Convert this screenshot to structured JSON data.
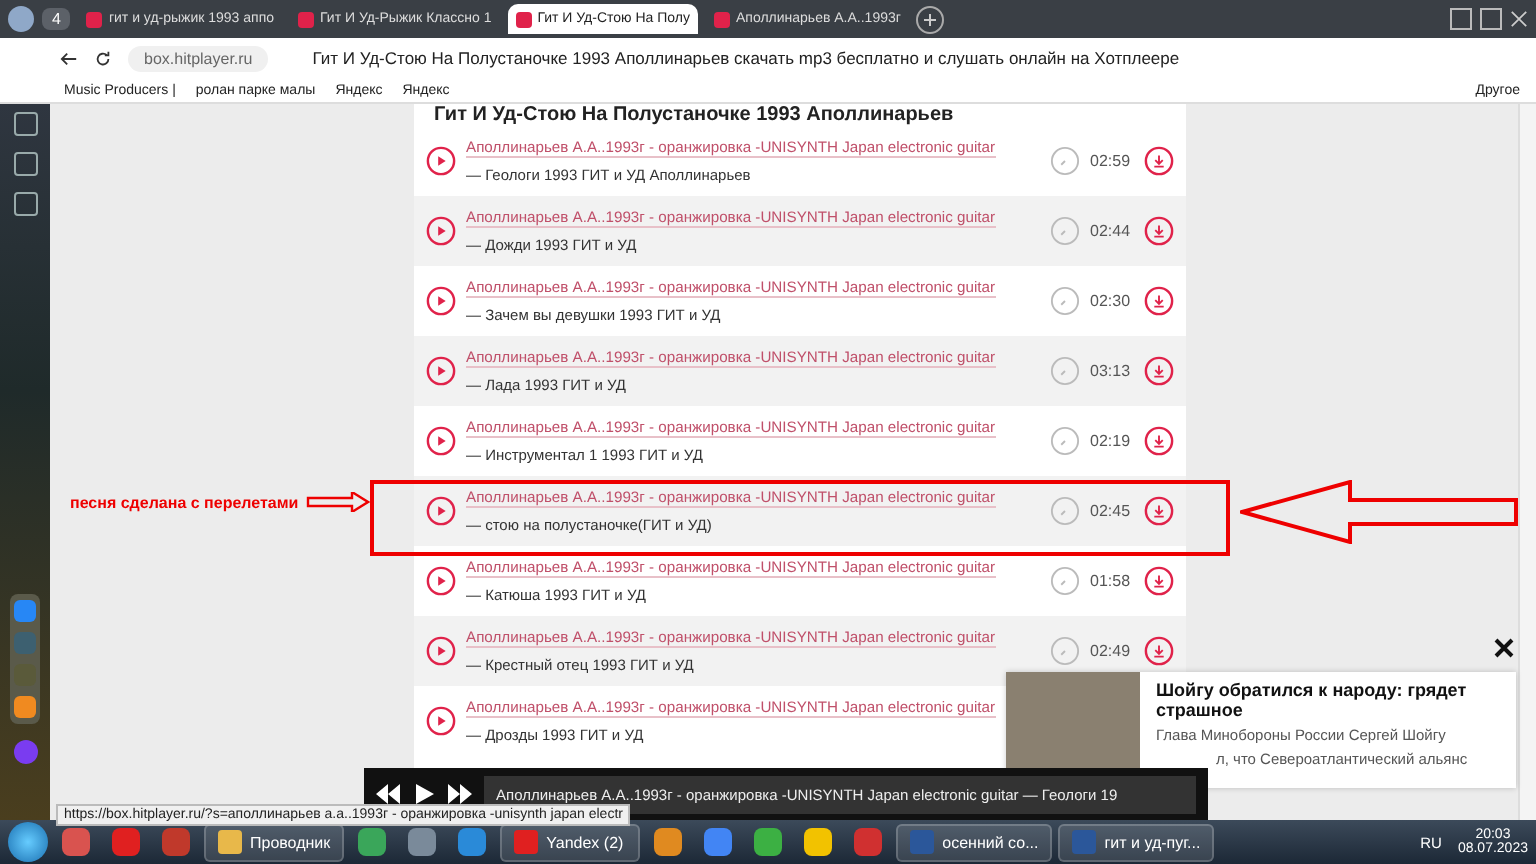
{
  "browser": {
    "tab_count": "4",
    "tabs": [
      {
        "title": "гит и уд-рыжик 1993 аппо",
        "selected": false
      },
      {
        "title": "Гит И Уд-Рыжик Классно 1",
        "selected": false
      },
      {
        "title": "Гит И Уд-Стою На Полу",
        "selected": true
      },
      {
        "title": "Аполлинарьев А.А..1993г",
        "selected": false
      }
    ],
    "url": "box.hitplayer.ru",
    "page_title": "Гит И Уд-Стою На Полустаночке 1993 Аполлинарьев скачать mp3 бесплатно и слушать онлайн на Хотплеере",
    "bookmarks": [
      "Music Producers |",
      "ролан парке малы",
      "Яндекс",
      "Яндекс"
    ],
    "bookmarks_other": "Другое"
  },
  "page": {
    "heading": "Гит И Уд-Стою На Полустаночке 1993 Аполлинарьев",
    "tracks": [
      {
        "artist": "Аполлинарьев А.А..1993г - оранжировка -UNISYNTH Japan electronic guitar",
        "title": "— Геологи 1993 ГИТ и УД Аполлинарьев",
        "duration": "02:59"
      },
      {
        "artist": "Аполлинарьев А.А..1993г - оранжировка -UNISYNTH Japan electronic guitar",
        "title": "— Дожди 1993 ГИТ и УД",
        "duration": "02:44"
      },
      {
        "artist": "Аполлинарьев А.А..1993г - оранжировка -UNISYNTH Japan electronic guitar",
        "title": "— Зачем вы девушки 1993 ГИТ и УД",
        "duration": "02:30"
      },
      {
        "artist": "Аполлинарьев А.А..1993г - оранжировка -UNISYNTH Japan electronic guitar",
        "title": "— Лада 1993 ГИТ и УД",
        "duration": "03:13"
      },
      {
        "artist": "Аполлинарьев А.А..1993г - оранжировка -UNISYNTH Japan electronic guitar",
        "title": "— Инструментал 1 1993 ГИТ и УД",
        "duration": "02:19"
      },
      {
        "artist": "Аполлинарьев А.А..1993г - оранжировка -UNISYNTH Japan electronic guitar",
        "title": "— стою на полустаночке(ГИТ и УД)",
        "duration": "02:45"
      },
      {
        "artist": "Аполлинарьев А.А..1993г - оранжировка -UNISYNTH Japan electronic guitar",
        "title": "— Катюша 1993 ГИТ и УД",
        "duration": "01:58"
      },
      {
        "artist": "Аполлинарьев А.А..1993г - оранжировка -UNISYNTH Japan electronic guitar",
        "title": "— Крестный отец 1993 ГИТ и УД",
        "duration": "02:49"
      },
      {
        "artist": "Аполлинарьев А.А..1993г - оранжировка -UNISYNTH Japan electronic guitar",
        "title": "— Дрозды 1993 ГИТ и УД"
      }
    ]
  },
  "annotation": {
    "label": "песня сделана с перелетами"
  },
  "ad": {
    "headline": "Шойгу обратился к народу: грядет страшное",
    "lines": [
      "Глава Минобороны России Сергей Шойгу",
      "л, что Североатлантический альянс"
    ]
  },
  "player": {
    "now_playing": "Аполлинарьев А.А..1993г - оранжировка -UNISYNTH Japan electronic guitar — Геологи 19"
  },
  "status_url": "https://box.hitplayer.ru/?s=аполлинарьев а.а..1993г - оранжировка -unisynth japan electr",
  "taskbar": {
    "items": [
      {
        "kind": "icon",
        "color": "#d9534f"
      },
      {
        "kind": "icon",
        "color": "#e02020"
      },
      {
        "kind": "icon",
        "color": "#c0392b"
      },
      {
        "kind": "button",
        "label": "Проводник",
        "color": "#e8b84a"
      },
      {
        "kind": "icon",
        "color": "#3aa65a"
      },
      {
        "kind": "icon",
        "color": "#7a8a9a"
      },
      {
        "kind": "icon",
        "color": "#2a8ad8"
      },
      {
        "kind": "button",
        "label": "Yandex (2)",
        "color": "#e02020"
      },
      {
        "kind": "icon",
        "color": "#e08a20"
      },
      {
        "kind": "icon",
        "color": "#4285f4"
      },
      {
        "kind": "icon",
        "color": "#3cb043"
      },
      {
        "kind": "icon",
        "color": "#f2c200"
      },
      {
        "kind": "icon",
        "color": "#d03030"
      },
      {
        "kind": "button",
        "label": "осенний со...",
        "color": "#2b579a"
      },
      {
        "kind": "button",
        "label": "гит и уд-пуг...",
        "color": "#2b579a"
      }
    ],
    "language": "RU",
    "time": "20:03",
    "date": "08.07.2023"
  }
}
